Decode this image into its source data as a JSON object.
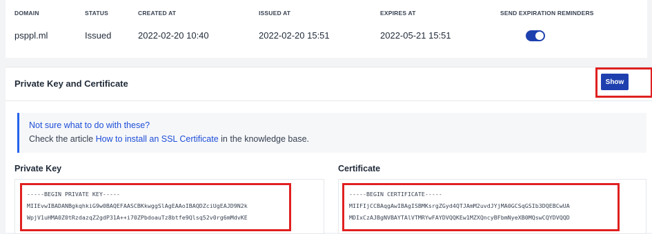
{
  "table": {
    "headers": {
      "domain": "DOMAIN",
      "status": "STATUS",
      "created_at": "CREATED AT",
      "issued_at": "ISSUED AT",
      "expires_at": "EXPIRES AT",
      "reminders": "SEND EXPIRATION REMINDERS"
    },
    "row": {
      "domain": "psppl.ml",
      "status": "Issued",
      "created_at": "2022-02-20 10:40",
      "issued_at": "2022-02-20 15:51",
      "expires_at": "2022-05-21 15:51",
      "reminders_enabled": true
    }
  },
  "private_key_section": {
    "title": "Private Key and Certificate",
    "show_button_label": "Show",
    "info": {
      "title": "Not sure what to do with these?",
      "text_before": "Check the article ",
      "link": "How to install an SSL Certificate",
      "text_after": " in the knowledge base."
    },
    "private_key": {
      "label": "Private Key",
      "lines": [
        "-----BEGIN PRIVATE KEY-----",
        "MIIEvwIBADANBgkqhkiG9w0BAQEFAASCBKkwggSlAgEAAoIBAQDZciUgEAJD9N2k",
        "WpjV1uHMA0Z0tRzdazqZ2gdP31A++i70ZPbdoauTz8btfe9Qlsq52v0rg6mMdvKE"
      ]
    },
    "certificate": {
      "label": "Certificate",
      "lines": [
        "-----BEGIN CERTIFICATE-----",
        "MIIFIjCCBAqgAwIBAgISBMKsrgZGyd4QTJAmM2uvdJYjMA0GCSqGSIb3DQEBCwUA",
        "MDIxCzAJBgNVBAYTAlVTMRYwFAYDVQQKEw1MZXQncyBFbmNyeXB0MQswCQYDVQQD"
      ]
    }
  },
  "colors": {
    "accent": "#1e40af",
    "link": "#1d4ed8",
    "highlight": "#e02020"
  }
}
